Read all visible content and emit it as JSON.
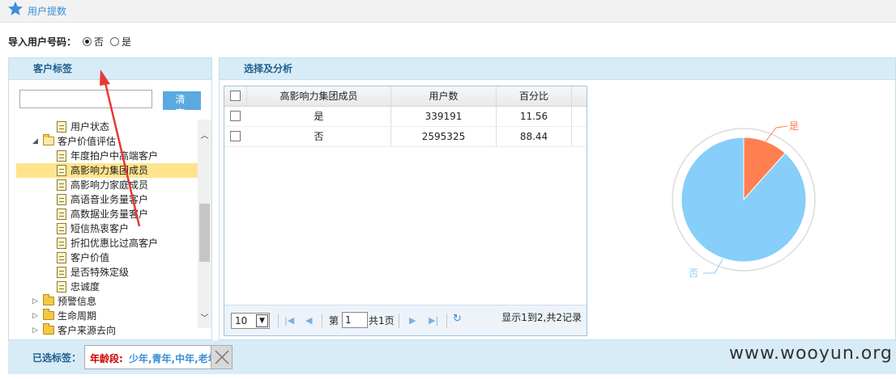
{
  "page_title": "用户提数",
  "import_row": {
    "label": "导入用户号码：",
    "options": [
      "否",
      "是"
    ],
    "selected": "否"
  },
  "left_panel": {
    "title": "客户标签",
    "clear_label": "清 空",
    "tree": [
      {
        "label": "用户状态",
        "type": "doc",
        "level": 2
      },
      {
        "label": "客户价值评估",
        "type": "folder-open",
        "level": 1,
        "expanded": true
      },
      {
        "label": "年度拍户中高端客户",
        "type": "doc",
        "level": 2
      },
      {
        "label": "高影响力集团成员",
        "type": "doc",
        "level": 2,
        "selected": true
      },
      {
        "label": "高影响力家庭成员",
        "type": "doc",
        "level": 2
      },
      {
        "label": "高语音业务量客户",
        "type": "doc",
        "level": 2
      },
      {
        "label": "高数据业务量客户",
        "type": "doc",
        "level": 2
      },
      {
        "label": "短信热衷客户",
        "type": "doc",
        "level": 2
      },
      {
        "label": "折扣优惠比过高客户",
        "type": "doc",
        "level": 2
      },
      {
        "label": "客户价值",
        "type": "doc",
        "level": 2
      },
      {
        "label": "是否特殊定级",
        "type": "doc",
        "level": 2
      },
      {
        "label": "忠诚度",
        "type": "doc",
        "level": 2
      },
      {
        "label": "预警信息",
        "type": "folder",
        "level": 1
      },
      {
        "label": "生命周期",
        "type": "folder",
        "level": 1
      },
      {
        "label": "客户来源去向",
        "type": "folder",
        "level": 1
      }
    ]
  },
  "right_panel": {
    "title": "选择及分析",
    "table": {
      "columns": [
        "高影响力集团成员",
        "用户数",
        "百分比"
      ],
      "rows": [
        {
          "c1": "是",
          "c2": "339191",
          "c3": "11.56"
        },
        {
          "c1": "否",
          "c2": "2595325",
          "c3": "88.44"
        }
      ]
    },
    "pager": {
      "page_size": "10",
      "page_prefix": "第",
      "page_value": "1",
      "page_suffix": "共1页",
      "info": "显示1到2,共2记录"
    }
  },
  "chart_data": {
    "type": "pie",
    "categories": [
      "是",
      "否"
    ],
    "values": [
      11.56,
      88.44
    ],
    "colors": [
      "#ff7f50",
      "#87cefa"
    ]
  },
  "bottom": {
    "label": "已选标签：",
    "tag_key": "年龄段:",
    "tag_values": "少年,青年,中年,老年"
  },
  "watermark": "www.wooyun.org",
  "colors": {
    "accent": "#3a8fd8",
    "panel_header": "#d7ecf7",
    "selected_row": "#ffe48d"
  }
}
